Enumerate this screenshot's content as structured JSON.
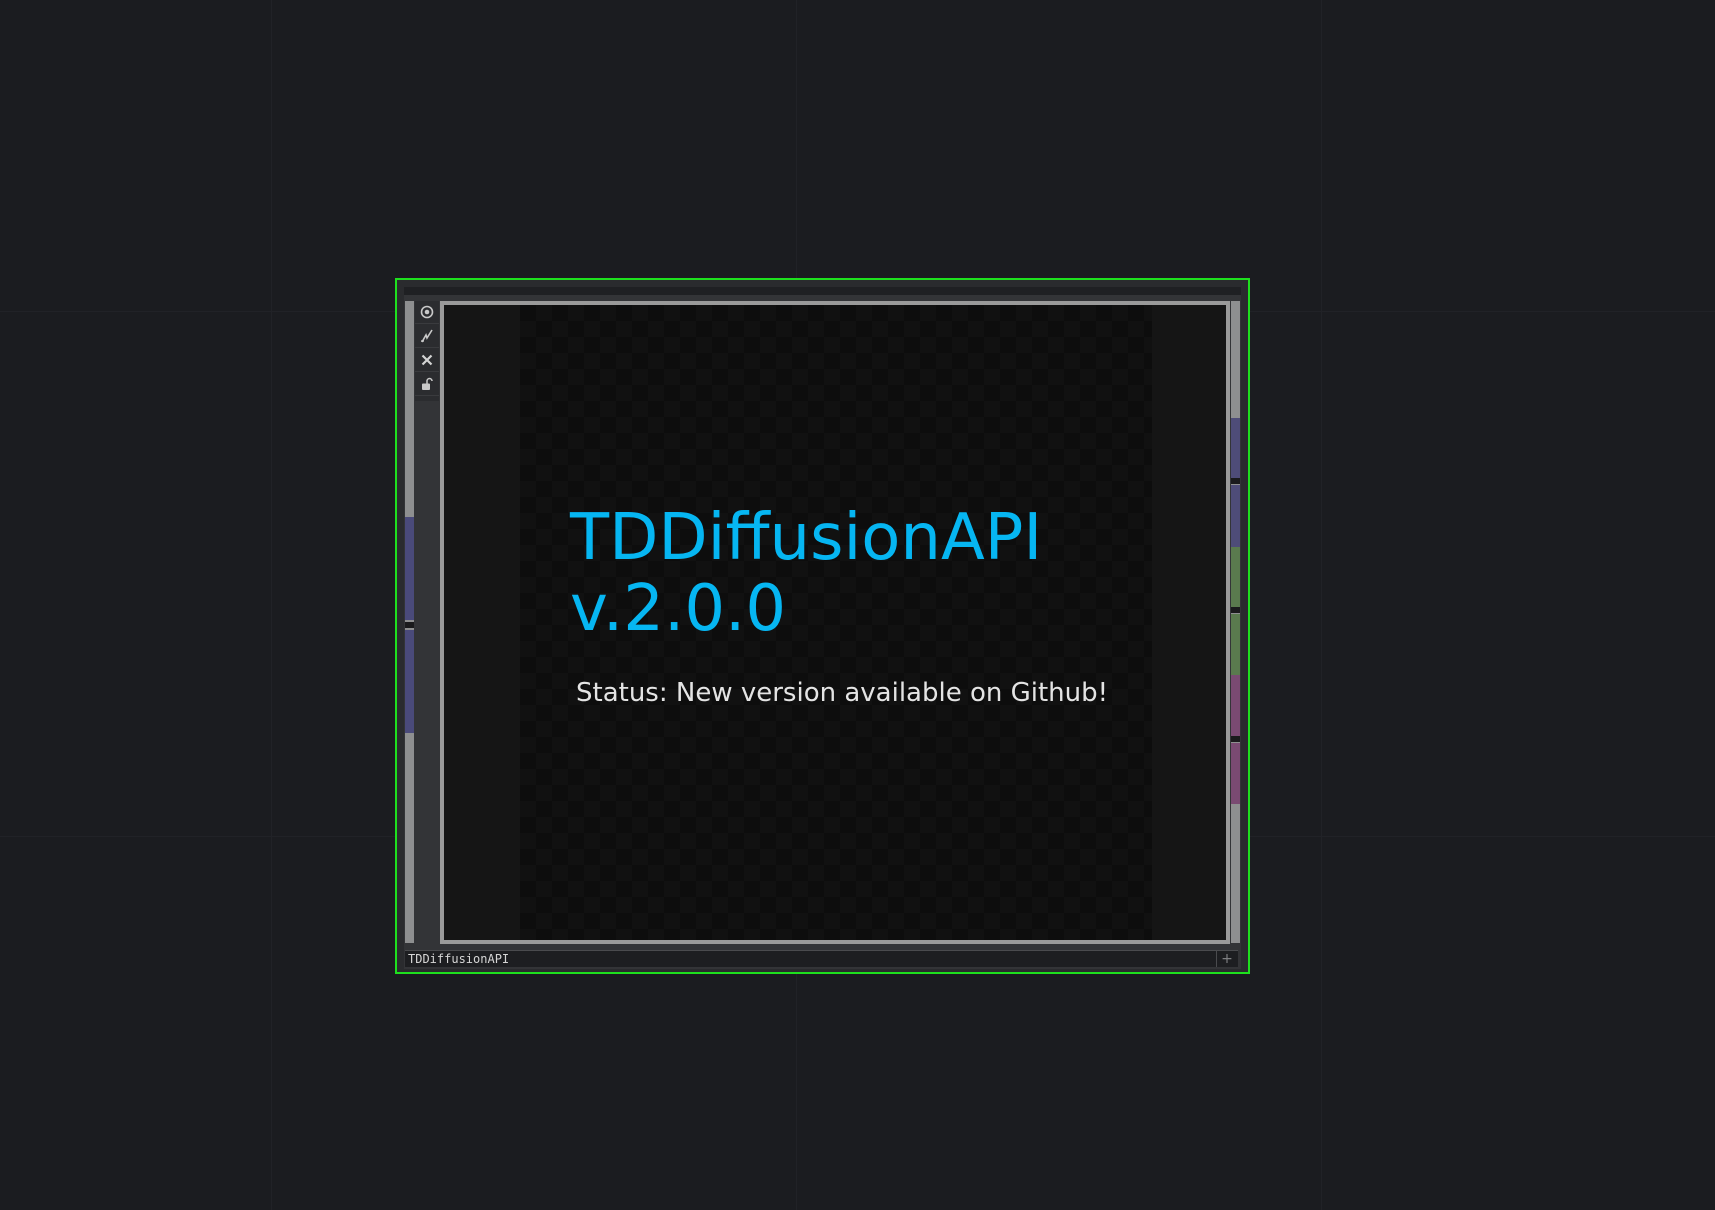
{
  "colors": {
    "network_background": "#1b1c20",
    "node_selected_border": "#1ee01e",
    "title_color": "#06b6f2",
    "status_color": "#e4e4e4",
    "input_connector_color": "#4a4a7a",
    "output_connector_colors": [
      "#4e4c78",
      "#4e4c78",
      "#5a7a4e",
      "#5a7a4e",
      "#7a4a72",
      "#7a4a72"
    ]
  },
  "toolbar": {
    "icons": [
      "viewer-active-icon",
      "bypass-icon",
      "delete-icon",
      "lock-icon"
    ]
  },
  "viewer": {
    "title_line1": "TDDiffusionAPI",
    "title_line2": "v.2.0.0",
    "status_text": "Status: New version available on Github!"
  },
  "node": {
    "name": "TDDiffusionAPI",
    "add_symbol": "+"
  }
}
